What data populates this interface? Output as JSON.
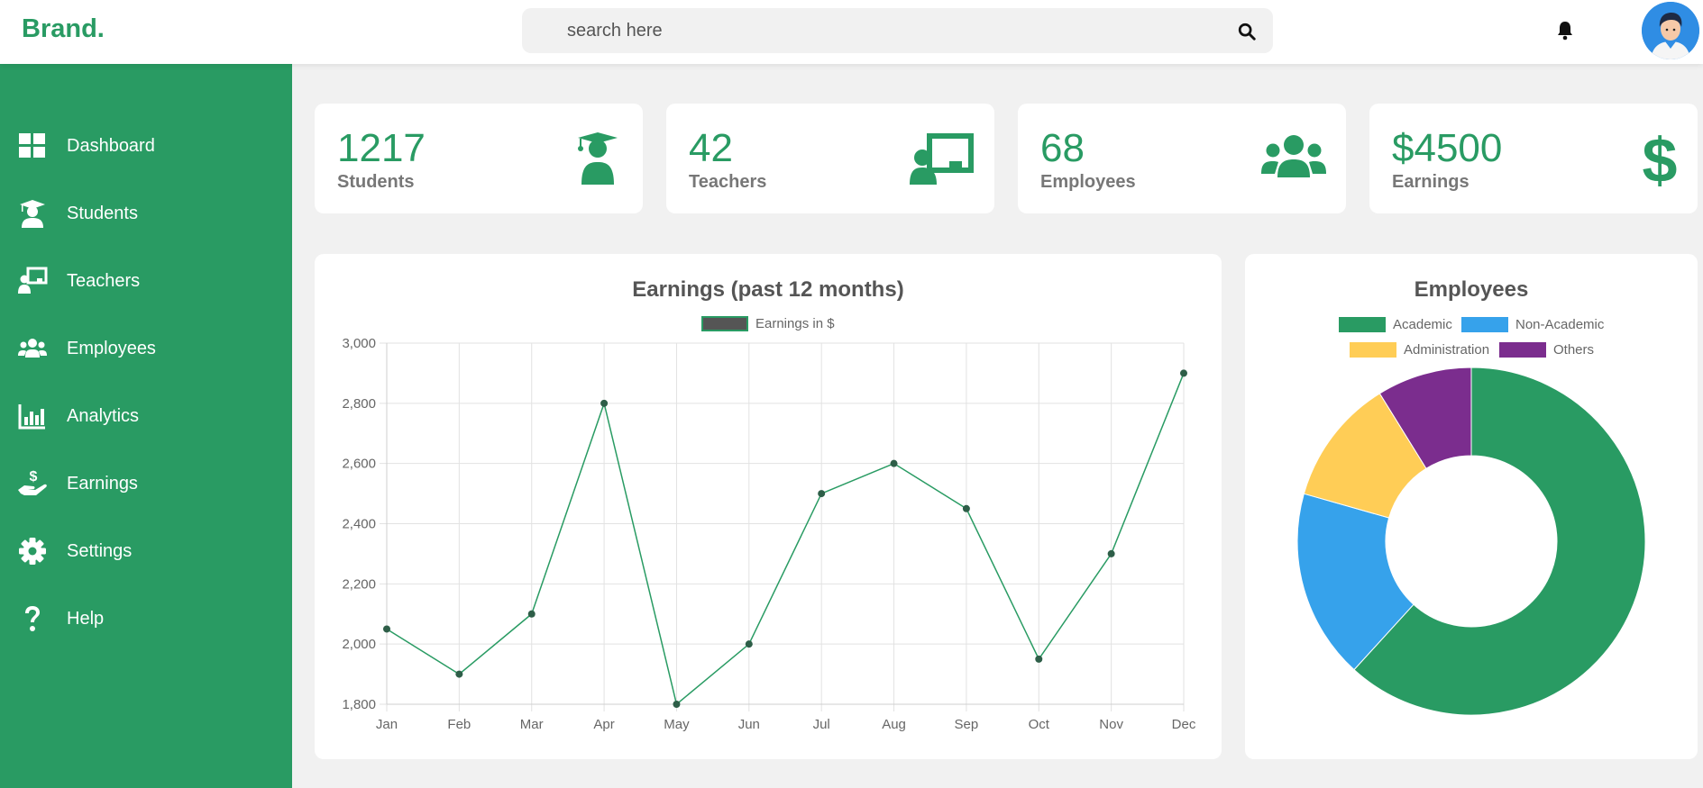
{
  "header": {
    "brand": "Brand.",
    "search_placeholder": "search here"
  },
  "sidebar": {
    "items": [
      {
        "label": "Dashboard",
        "icon": "dashboard-icon"
      },
      {
        "label": "Students",
        "icon": "student-icon"
      },
      {
        "label": "Teachers",
        "icon": "teacher-icon"
      },
      {
        "label": "Employees",
        "icon": "users-icon"
      },
      {
        "label": "Analytics",
        "icon": "chart-icon"
      },
      {
        "label": "Earnings",
        "icon": "hand-dollar-icon"
      },
      {
        "label": "Settings",
        "icon": "gear-icon"
      },
      {
        "label": "Help",
        "icon": "question-icon"
      }
    ]
  },
  "cards": [
    {
      "value": "1217",
      "label": "Students",
      "icon": "graduate-icon"
    },
    {
      "value": "42",
      "label": "Teachers",
      "icon": "teacher-board-icon"
    },
    {
      "value": "68",
      "label": "Employees",
      "icon": "users-icon"
    },
    {
      "value": "$4500",
      "label": "Earnings",
      "icon": "dollar-icon"
    }
  ],
  "colors": {
    "primary": "#299b63",
    "academic": "#299b63",
    "non_academic": "#36a2eb",
    "administration": "#ffcd56",
    "others": "#7b2d8e",
    "line_legend": "#555555"
  },
  "chart_data": [
    {
      "type": "line",
      "title": "Earnings (past 12 months)",
      "categories": [
        "Jan",
        "Feb",
        "Mar",
        "Apr",
        "May",
        "Jun",
        "Jul",
        "Aug",
        "Sep",
        "Oct",
        "Nov",
        "Dec"
      ],
      "series": [
        {
          "name": "Earnings in $",
          "values": [
            2050,
            1900,
            2100,
            2800,
            1800,
            2000,
            2500,
            2600,
            2450,
            1950,
            2300,
            2900
          ]
        }
      ],
      "ylim": [
        1800,
        3000
      ],
      "yticks": [
        "1,800",
        "2,000",
        "2,200",
        "2,400",
        "2,600",
        "2,800",
        "3,000"
      ],
      "grid": true,
      "legend": "top"
    },
    {
      "type": "pie",
      "title": "Employees",
      "categories": [
        "Academic",
        "Non-Academic",
        "Administration",
        "Others"
      ],
      "values": [
        42,
        12,
        8,
        6
      ],
      "legend": "top"
    }
  ]
}
